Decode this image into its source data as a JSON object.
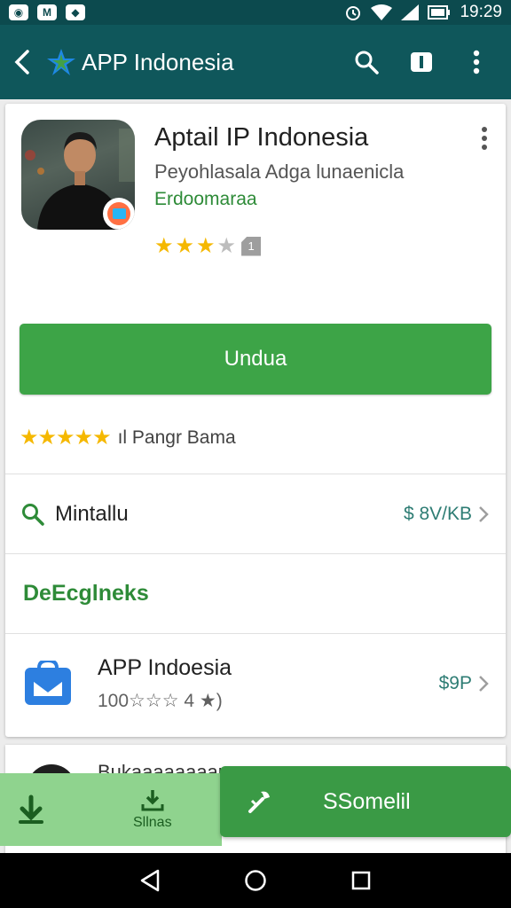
{
  "status_bar": {
    "time": "19:29",
    "left_icons": [
      "vpn-icon",
      "mail-icon",
      "shield-icon"
    ],
    "right_icons": [
      "alarm-icon",
      "wifi-icon",
      "signal-icon",
      "battery-icon"
    ]
  },
  "app_bar": {
    "title": "APP Indonesia",
    "actions": [
      "search-icon",
      "info-icon",
      "more-vert-icon"
    ]
  },
  "app_details": {
    "title": "Aptail IP Indonesia",
    "developer": "Peyohlasala Adga lunaenicla",
    "category": "Erdoomaraa",
    "rating_stars": 3.5,
    "rank_badge": "1"
  },
  "install_button": {
    "label": "Undua"
  },
  "rating_summary": {
    "stars": "★★★★★",
    "text": "ıl Pangr Bama"
  },
  "search_row": {
    "label": "Mintallu",
    "value": "$ 8V/KB"
  },
  "section": {
    "title": "DeEcglneks"
  },
  "related_app": {
    "name": "APP Indoesia",
    "meta": "100☆☆☆ 4 ★)",
    "price": "$9P"
  },
  "partial_card": {
    "text": "Bukaaaaaaaan"
  },
  "bottom_actions": {
    "secondary_label": "Sllnas",
    "primary_label": "SSomelil"
  },
  "colors": {
    "status_bar": "#0c4a4e",
    "app_bar": "#0f575b",
    "accent_green": "#3da447",
    "star": "#f5b800"
  }
}
